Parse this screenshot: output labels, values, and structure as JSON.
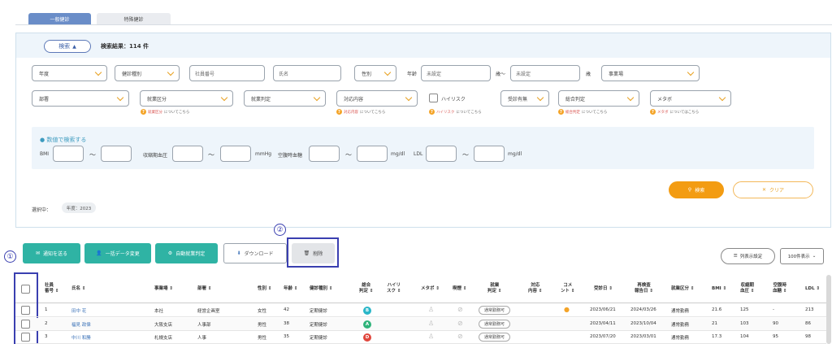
{
  "tabs": [
    "一般健診",
    "特殊健診"
  ],
  "search": {
    "toggle_label": "検索",
    "result": "検索結果：114 件",
    "row1": {
      "year": "年度",
      "checkup_type": "健診種別",
      "employee_no": "社員番号",
      "name": "氏名",
      "gender": "性別",
      "age_label": "年齢",
      "age_from_ph": "未設定",
      "age_sep": "歳〜",
      "age_to_ph": "未設定",
      "age_unit": "歳",
      "office": "事業場"
    },
    "row2": {
      "dept": "部署",
      "work_class": "就業区分",
      "work_judge": "就業判定",
      "response": "対応内容",
      "high_risk": "ハイリスク",
      "consult": "受診有無",
      "overall": "総合判定",
      "metabo": "メタボ"
    },
    "notes": {
      "n1a": "就業区分",
      "n1b": "についてこちら",
      "n2a": "対応内容",
      "n2b": "についてこちら",
      "n3a": "ハイリスク",
      "n3b": "についてこちら",
      "n4a": "総合判定",
      "n4b": "についてこちら",
      "n5a": "メタボ",
      "n5b": "についてはこちら"
    },
    "numeric": {
      "title": "● 数値で検索する",
      "bmi": "BMI",
      "tilde": "〜",
      "sbp": "収縮期血圧",
      "mmhg": "mmHg",
      "fbs": "空腹時血糖",
      "mgdl": "mg/dl",
      "ldl": "LDL",
      "mgdl2": "mg/dl"
    },
    "search_btn": "検索",
    "clear_btn": "クリア",
    "selected_label": "選択中：",
    "selected_chip": "年度：2023"
  },
  "annot": {
    "one": "①",
    "two": "②"
  },
  "actions": {
    "notify": "通知を送る",
    "bulk": "一括データ変更",
    "auto": "自動就業判定",
    "download": "ダウンロード",
    "delete": "削除"
  },
  "right": {
    "columns": "列表示設定",
    "per_page": "100件表示"
  },
  "headers": {
    "emp_no_1": "社員",
    "emp_no_2": "番号 ⇕",
    "name": "氏名 ⇕",
    "office": "事業場 ⇕",
    "dept": "部署 ⇕",
    "gender": "性別 ⇕",
    "age": "年齢 ⇕",
    "type": "健診種別 ⇕",
    "overall_1": "総合",
    "overall_2": "判定 ⇕",
    "risk_1": "ハイリ",
    "risk_2": "スク ⇕",
    "metabo": "メタボ ⇕",
    "smoke": "喫煙 ⇕",
    "work_1": "就業",
    "work_2": "判定 ⇕",
    "resp_1": "対応",
    "resp_2": "内容 ⇕",
    "comment_1": "コメ",
    "comment_2": "ント ⇕",
    "exam_date": "受診日 ⇕",
    "recheck_1": "再検査",
    "recheck_2": "報告日 ⇕",
    "work_class": "就業区分 ⇕",
    "bmi": "BMI ⇕",
    "sbp_1": "収縮期",
    "sbp_2": "血圧 ⇕",
    "fbs_1": "空腹時",
    "fbs_2": "血糖 ⇕",
    "ldl": "LDL ⇕"
  },
  "rows": [
    {
      "no": "1",
      "name": "田中 花",
      "office": "本社",
      "dept": "経営企画室",
      "gender": "女性",
      "age": "42",
      "type": "定期健診",
      "overall": "B",
      "overall_color": "#29b6c8",
      "work": "通常勤務可",
      "exam": "2023/06/21",
      "recheck": "2024/03/26",
      "class": "通常勤務",
      "bmi": "21.6",
      "sbp": "125",
      "fbs": "-",
      "ldl": "213"
    },
    {
      "no": "2",
      "name": "福見 政偉",
      "office": "大阪支店",
      "dept": "人事部",
      "gender": "男性",
      "age": "38",
      "type": "定期健診",
      "overall": "A",
      "overall_color": "#2fb37a",
      "work": "通常勤務可",
      "exam": "2023/04/11",
      "recheck": "2023/10/04",
      "class": "通常勤務",
      "bmi": "21",
      "sbp": "103",
      "fbs": "90",
      "ldl": "86"
    },
    {
      "no": "3",
      "name": "中川 和勝",
      "office": "札幌支店",
      "dept": "人事",
      "gender": "男性",
      "age": "35",
      "type": "定期健診",
      "overall": "D",
      "overall_color": "#e0463c",
      "work": "通常勤務可",
      "exam": "2023/07/20",
      "recheck": "2023/03/01",
      "class": "通常勤務",
      "bmi": "17.3",
      "sbp": "104",
      "fbs": "95",
      "ldl": "98"
    }
  ]
}
